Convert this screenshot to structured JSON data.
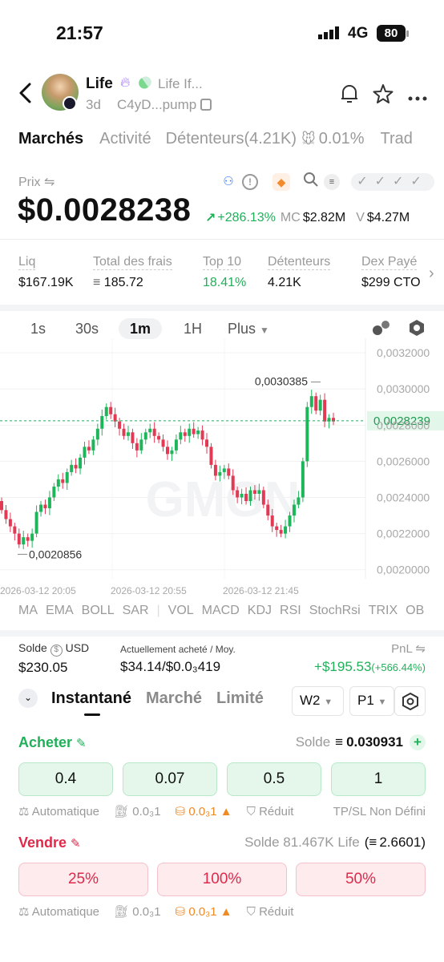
{
  "status_bar": {
    "time": "21:57",
    "network": "4G",
    "battery": "80"
  },
  "token": {
    "name": "Life",
    "tag": "Life If...",
    "age": "3d",
    "address": "C4yD...pump"
  },
  "tabs": [
    {
      "label": "Marchés",
      "active": true
    },
    {
      "label": "Activité",
      "active": false
    },
    {
      "label": "Détenteurs(4.21K)",
      "active": false
    },
    {
      "label": "0.01%",
      "active": false
    },
    {
      "label": "Trad",
      "active": false
    }
  ],
  "price": {
    "label": "Prix",
    "value": "$0.0028238",
    "change": "+286.13%",
    "mc_label": "MC",
    "mc_value": "$2.82M",
    "v_label": "V",
    "v_value": "$4.27M"
  },
  "stats": [
    {
      "label": "Liq",
      "value": "$167.19K",
      "color": "#111"
    },
    {
      "label": "Total des frais",
      "value": "185.72",
      "color": "#111"
    },
    {
      "label": "Top 10",
      "value": "18.41%",
      "color": "#21b05a"
    },
    {
      "label": "Détenteurs",
      "value": "4.21K",
      "color": "#111"
    },
    {
      "label": "Dex Payé",
      "value": "$299 CTO",
      "color": "#111"
    }
  ],
  "timeframes": {
    "items": [
      "1s",
      "30s",
      "1m",
      "1H"
    ],
    "active": "1m",
    "more": "Plus"
  },
  "chart_data": {
    "type": "candlestick",
    "ylim": [
      0.00195,
      0.00328
    ],
    "yticks": [
      "0,0032000",
      "0,0030000",
      "0,0028000",
      "0,0026000",
      "0,0024000",
      "0,0022000",
      "0,0020000"
    ],
    "ytick_values": [
      0.0032,
      0.003,
      0.0028,
      0.0026,
      0.0024,
      0.0022,
      0.002
    ],
    "xticks": [
      "2026-03-12 20:05",
      "2026-03-12 20:55",
      "2026-03-12 21:45"
    ],
    "current_price_label": "0,0028239",
    "current_price": 0.0028239,
    "high_label": "0,0030385",
    "high": 0.0030385,
    "low_label": "0,0020856",
    "low": 0.0020856,
    "watermark": "GMGN",
    "colors": {
      "up": "#1fb65b",
      "down": "#e23a55"
    }
  },
  "indicators": [
    "MA",
    "EMA",
    "BOLL",
    "SAR",
    "VOL",
    "MACD",
    "KDJ",
    "RSI",
    "StochRsi",
    "TRIX",
    "OB"
  ],
  "position": {
    "solde_label": "Solde",
    "solde_unit": "USD",
    "solde_value": "$230.05",
    "bought_label": "Actuellement acheté / Moy.",
    "bought_value": "$34.14/$0.0₃419",
    "pnl_label": "PnL",
    "pnl_value": "+$195.53",
    "pnl_pct": "(+566.44%)"
  },
  "order_tabs": {
    "items": [
      "Instantané",
      "Marché",
      "Limité"
    ],
    "active": "Instantané",
    "wallet": "W2",
    "preset": "P1"
  },
  "buy": {
    "label": "Acheter",
    "balance_label": "Solde",
    "balance_value": "0.030931",
    "amounts": [
      "0.4",
      "0.07",
      "0.5",
      "1"
    ],
    "opts": {
      "auto": "Automatique",
      "fee": "0.0₃1",
      "priority": "0.0₃1",
      "mev": "Réduit",
      "tpsl": "TP/SL Non Défini"
    }
  },
  "sell": {
    "label": "Vendre",
    "balance_text": "Solde 81.467K Life",
    "balance_sol": "2.6601",
    "amounts": [
      "25%",
      "100%",
      "50%"
    ],
    "opts": {
      "auto": "Automatique",
      "fee": "0.0₃1",
      "priority": "0.0₃1",
      "mev": "Réduit"
    }
  }
}
